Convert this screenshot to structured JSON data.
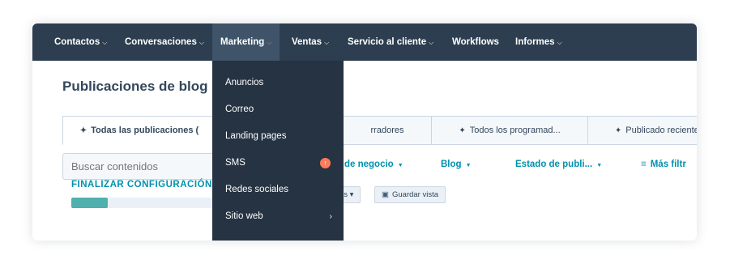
{
  "nav": {
    "items": [
      {
        "label": "Contactos",
        "chevron": "⌵"
      },
      {
        "label": "Conversaciones",
        "chevron": "⌵"
      },
      {
        "label": "Marketing",
        "chevron": "⌵"
      },
      {
        "label": "Ventas",
        "chevron": "⌵"
      },
      {
        "label": "Servicio al cliente",
        "chevron": "⌵"
      },
      {
        "label": "Workflows"
      },
      {
        "label": "Informes",
        "chevron": "⌵"
      }
    ]
  },
  "marketing_menu": {
    "items": [
      {
        "label": "Anuncios"
      },
      {
        "label": "Correo"
      },
      {
        "label": "Landing pages"
      },
      {
        "label": "SMS",
        "badge": "↑"
      },
      {
        "label": "Redes sociales"
      },
      {
        "label": "Sitio web",
        "arrow": "›"
      }
    ]
  },
  "page": {
    "title": "Publicaciones de blog"
  },
  "tabs": [
    {
      "pin": "✦",
      "label": "Todas las publicaciones ("
    },
    {
      "label": "rradores"
    },
    {
      "pin": "✦",
      "label": "Todos los programad..."
    },
    {
      "pin": "✦",
      "label": "Publicado recientem..."
    }
  ],
  "search": {
    "placeholder": "Buscar contenidos"
  },
  "filters": [
    {
      "label": "de negocio",
      "caret": "▼"
    },
    {
      "label": "Blog",
      "caret": "▼"
    },
    {
      "label": "Estado de publi...",
      "caret": "▼"
    },
    {
      "icon": "≡",
      "label": "Más filtr"
    }
  ],
  "setup": {
    "label": "FINALIZAR CONFIGURACIÓN",
    "progress": 0.25
  },
  "actions": {
    "columns_label": "es ▾",
    "save_view_label": "Guardar vista",
    "save_icon": "▣"
  },
  "colors": {
    "nav_bg": "#2d3e50",
    "menu_bg": "#253342",
    "accent_teal": "#0091ae",
    "accent_orange": "#ff7a59",
    "progress": "#4fb0ae"
  }
}
